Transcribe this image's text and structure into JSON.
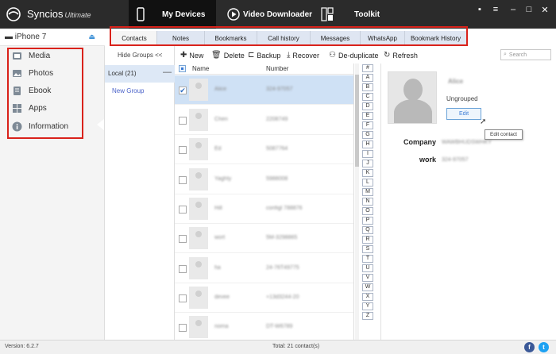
{
  "app": {
    "name": "Syncios",
    "edition": "Ultimate",
    "nav": [
      {
        "label": "My Devices",
        "icon": "phone-icon",
        "active": true
      },
      {
        "label": "Video Downloader",
        "icon": "play-icon",
        "active": false
      },
      {
        "label": "Toolkit",
        "icon": "toolkit-icon",
        "active": false
      }
    ]
  },
  "device": {
    "name": "iPhone 7"
  },
  "sidebar": {
    "items": [
      {
        "label": "Media",
        "icon": "media-icon"
      },
      {
        "label": "Photos",
        "icon": "photos-icon"
      },
      {
        "label": "Ebook",
        "icon": "ebook-icon"
      },
      {
        "label": "Apps",
        "icon": "apps-icon"
      },
      {
        "label": "Information",
        "icon": "info-icon",
        "selected": true
      }
    ]
  },
  "categories": [
    "Contacts",
    "Notes",
    "Bookmarks",
    "Call history",
    "Messages",
    "WhatsApp",
    "Bookmark History"
  ],
  "groups": {
    "hide_label": "Hide Groups <<",
    "local": "Local (21)",
    "new_group": "New Group"
  },
  "toolbar": {
    "new": "New",
    "delete": "Delete",
    "backup": "Backup",
    "recover": "Recover",
    "dedupe": "De-duplicate",
    "refresh": "Refresh",
    "search_placeholder": "Search"
  },
  "list": {
    "headers": {
      "name": "Name",
      "number": "Number"
    },
    "rows": [
      {
        "name": "Alice",
        "number": "324-97057",
        "selected": true
      },
      {
        "name": "Chen",
        "number": "2208749",
        "selected": false
      },
      {
        "name": "Ed",
        "number": "5087764",
        "selected": false
      },
      {
        "name": "Yaghty",
        "number": "5988008",
        "selected": false
      },
      {
        "name": "Hill",
        "number": "configl 788876",
        "selected": false
      },
      {
        "name": "wort",
        "number": "5M-3298865",
        "selected": false
      },
      {
        "name": "ha",
        "number": "24-76T49775",
        "selected": false
      },
      {
        "name": "devee",
        "number": "+13d3244-20",
        "selected": false
      },
      {
        "name": "noma",
        "number": "DT-W6789",
        "selected": false
      }
    ]
  },
  "alphabet": [
    "#",
    "A",
    "B",
    "C",
    "D",
    "E",
    "F",
    "G",
    "H",
    "I",
    "J",
    "K",
    "L",
    "M",
    "N",
    "O",
    "P",
    "Q",
    "R",
    "S",
    "T",
    "U",
    "V",
    "W",
    "X",
    "Y",
    "Z"
  ],
  "detail": {
    "name": "Alice",
    "group": "Ungrouped",
    "edit_label": "Edit",
    "tooltip": "Edit contact",
    "company_label": "Company",
    "company_value": "WAWBHUDSWHKY",
    "work_label": "work",
    "work_value": "324-97057"
  },
  "status": {
    "version": "Version: 6.2.7",
    "total": "Total: 21 contact(s)"
  },
  "colors": {
    "titlebar": "#2b2b2b",
    "highlight_box": "#d9221b",
    "tab_bg": "#dfe6f2",
    "selected_row": "#cfe1f5"
  }
}
